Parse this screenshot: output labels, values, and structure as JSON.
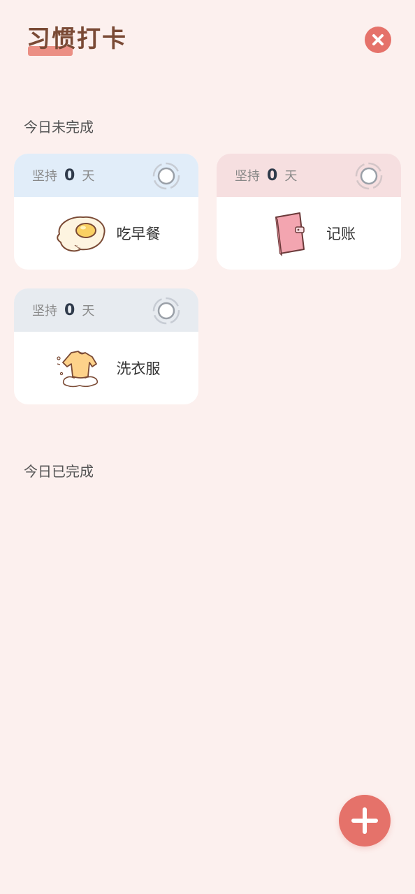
{
  "header": {
    "title": "习惯打卡"
  },
  "sections": {
    "incomplete_label": "今日未完成",
    "complete_label": "今日已完成"
  },
  "habits": [
    {
      "streak_prefix": "坚持",
      "streak_count": "0",
      "streak_unit": "天",
      "name": "吃早餐",
      "icon": "fried-egg-icon",
      "header_color": "#e1edf9"
    },
    {
      "streak_prefix": "坚持",
      "streak_count": "0",
      "streak_unit": "天",
      "name": "记账",
      "icon": "notebook-icon",
      "header_color": "#f6dfe0"
    },
    {
      "streak_prefix": "坚持",
      "streak_count": "0",
      "streak_unit": "天",
      "name": "洗衣服",
      "icon": "laundry-shirt-icon",
      "header_color": "#e7ebf0"
    }
  ],
  "colors": {
    "background": "#fcf0ee",
    "accent": "#e5726a",
    "title": "#7a4a35"
  },
  "icons": {
    "close": "close-icon",
    "add": "plus-icon",
    "check": "checkbox-ring-icon"
  }
}
